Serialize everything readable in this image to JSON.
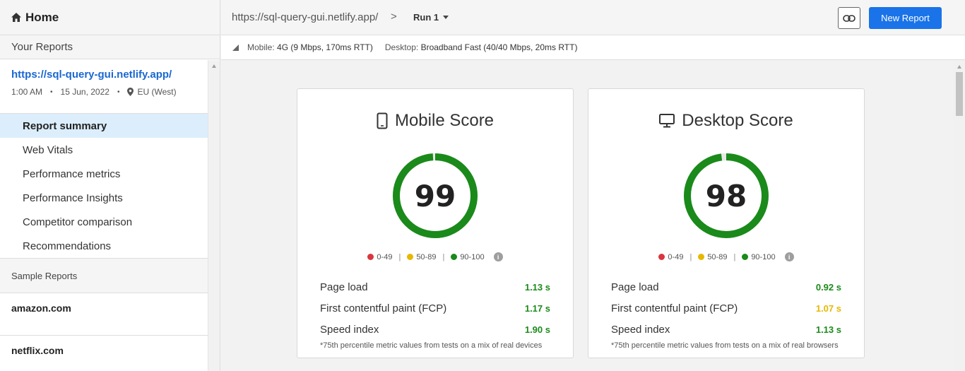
{
  "sidebar": {
    "home": "Home",
    "your_reports": "Your Reports",
    "report": {
      "url": "https://sql-query-gui.netlify.app/",
      "time": "1:00 AM",
      "date": "15 Jun, 2022",
      "region": "EU (West)"
    },
    "nav": [
      "Report summary",
      "Web Vitals",
      "Performance metrics",
      "Performance Insights",
      "Competitor comparison",
      "Recommendations"
    ],
    "sample_reports": "Sample Reports",
    "samples": [
      "amazon.com",
      "netflix.com"
    ]
  },
  "topbar": {
    "url": "https://sql-query-gui.netlify.app/",
    "separator": ">",
    "run": "Run 1",
    "new_report": "New Report"
  },
  "connection": {
    "mobile_label": "Mobile:",
    "mobile_value": "4G (9 Mbps, 170ms RTT)",
    "desktop_label": "Desktop:",
    "desktop_value": "Broadband Fast (40/40 Mbps, 20ms RTT)"
  },
  "legend": {
    "low": "0-49",
    "mid": "50-89",
    "high": "90-100",
    "info": "i"
  },
  "colors": {
    "good": "#1a8a1a",
    "average": "#e6b800",
    "poor": "#d9363e",
    "accent": "#1a73e8"
  },
  "cards": [
    {
      "title": "Mobile Score",
      "score": "99",
      "score_value": 99,
      "metrics": [
        {
          "label": "Page load",
          "value": "1.13 s",
          "status": "good"
        },
        {
          "label": "First contentful paint (FCP)",
          "value": "1.17 s",
          "status": "good"
        },
        {
          "label": "Speed index",
          "value": "1.90 s",
          "status": "good"
        }
      ],
      "footnote": "*75th percentile metric values from tests on a mix of real devices"
    },
    {
      "title": "Desktop Score",
      "score": "98",
      "score_value": 98,
      "metrics": [
        {
          "label": "Page load",
          "value": "0.92 s",
          "status": "good"
        },
        {
          "label": "First contentful paint (FCP)",
          "value": "1.07 s",
          "status": "average"
        },
        {
          "label": "Speed index",
          "value": "1.13 s",
          "status": "good"
        }
      ],
      "footnote": "*75th percentile metric values from tests on a mix of real browsers"
    }
  ]
}
